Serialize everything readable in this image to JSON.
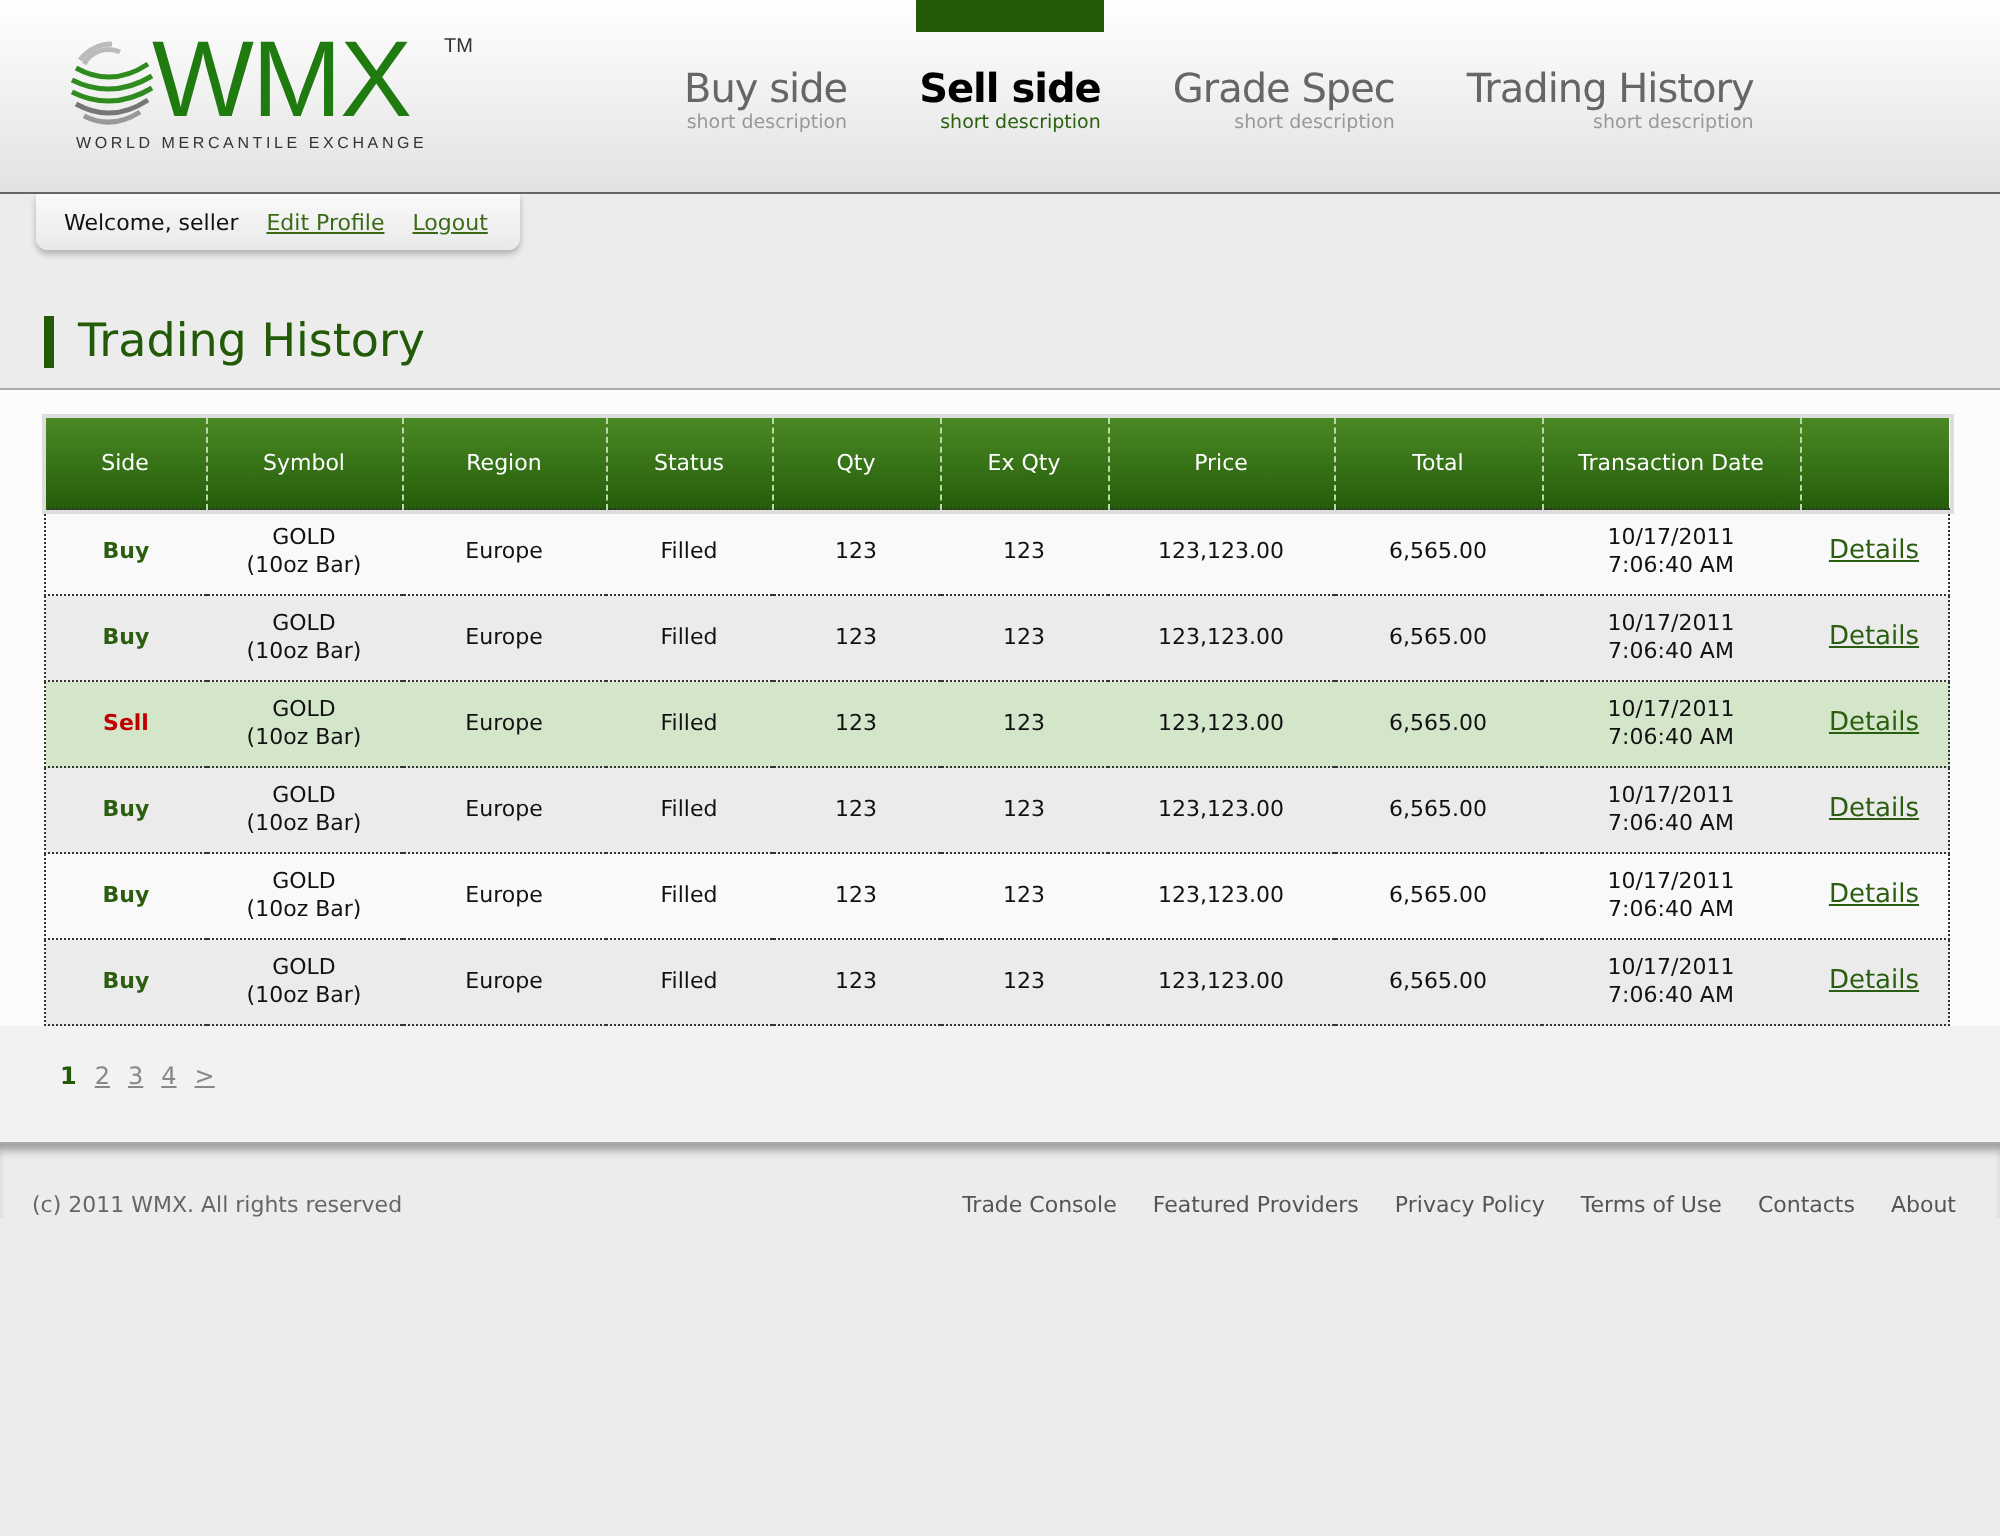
{
  "logo": {
    "mark": "WMX",
    "trademark": "TM",
    "tagline": "WORLD MERCANTILE EXCHANGE"
  },
  "nav": [
    {
      "label": "Buy side",
      "description": "short description",
      "selected": false
    },
    {
      "label": "Sell side",
      "description": "short description",
      "selected": true
    },
    {
      "label": "Grade Spec",
      "description": "short description",
      "selected": false
    },
    {
      "label": "Trading History",
      "description": "short description",
      "selected": false
    }
  ],
  "user_bar": {
    "welcome": "Welcome, seller",
    "links": [
      "Edit Profile",
      "Logout"
    ]
  },
  "page_title": "Trading History",
  "table": {
    "columns": [
      "Side",
      "Symbol",
      "Region",
      "Status",
      "Qty",
      "Ex Qty",
      "Price",
      "Total",
      "Transaction Date",
      ""
    ],
    "rows": [
      {
        "side": "Buy",
        "kind": "buy",
        "symbol": "GOLD",
        "unit": "(10oz Bar)",
        "region": "Europe",
        "status": "Filled",
        "qty": "123",
        "ex_qty": "123",
        "price": "123,123.00",
        "total": "6,565.00",
        "date": "10/17/2011",
        "time": "7:06:40 AM",
        "action": "Details",
        "selected": false
      },
      {
        "side": "Buy",
        "kind": "buy",
        "symbol": "GOLD",
        "unit": "(10oz Bar)",
        "region": "Europe",
        "status": "Filled",
        "qty": "123",
        "ex_qty": "123",
        "price": "123,123.00",
        "total": "6,565.00",
        "date": "10/17/2011",
        "time": "7:06:40 AM",
        "action": "Details",
        "selected": false
      },
      {
        "side": "Sell",
        "kind": "sell",
        "symbol": "GOLD",
        "unit": "(10oz Bar)",
        "region": "Europe",
        "status": "Filled",
        "qty": "123",
        "ex_qty": "123",
        "price": "123,123.00",
        "total": "6,565.00",
        "date": "10/17/2011",
        "time": "7:06:40 AM",
        "action": "Details",
        "selected": true
      },
      {
        "side": "Buy",
        "kind": "buy",
        "symbol": "GOLD",
        "unit": "(10oz Bar)",
        "region": "Europe",
        "status": "Filled",
        "qty": "123",
        "ex_qty": "123",
        "price": "123,123.00",
        "total": "6,565.00",
        "date": "10/17/2011",
        "time": "7:06:40 AM",
        "action": "Details",
        "selected": false
      },
      {
        "side": "Buy",
        "kind": "buy",
        "symbol": "GOLD",
        "unit": "(10oz Bar)",
        "region": "Europe",
        "status": "Filled",
        "qty": "123",
        "ex_qty": "123",
        "price": "123,123.00",
        "total": "6,565.00",
        "date": "10/17/2011",
        "time": "7:06:40 AM",
        "action": "Details",
        "selected": false
      },
      {
        "side": "Buy",
        "kind": "buy",
        "symbol": "GOLD",
        "unit": "(10oz Bar)",
        "region": "Europe",
        "status": "Filled",
        "qty": "123",
        "ex_qty": "123",
        "price": "123,123.00",
        "total": "6,565.00",
        "date": "10/17/2011",
        "time": "7:06:40 AM",
        "action": "Details",
        "selected": false
      }
    ]
  },
  "pagination": [
    {
      "label": "1",
      "selected": true
    },
    {
      "label": "2",
      "selected": false
    },
    {
      "label": "3",
      "selected": false
    },
    {
      "label": "4",
      "selected": false
    },
    {
      "label": ">",
      "selected": false
    }
  ],
  "footer": {
    "copyright": "(c) 2011 WMX. All rights reserved",
    "links": [
      "Trade Console",
      "Featured Providers",
      "Privacy Policy",
      "Terms of Use",
      "Contacts",
      "About"
    ]
  }
}
